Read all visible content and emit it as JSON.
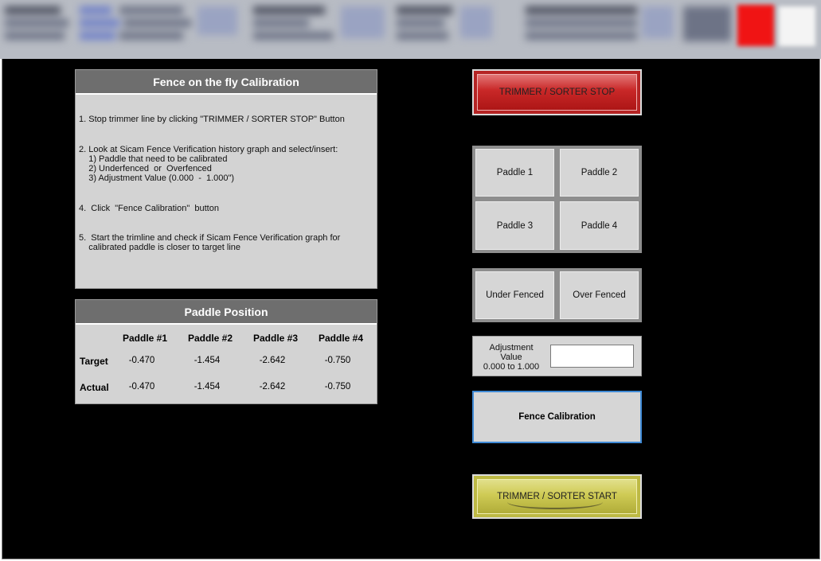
{
  "colors": {
    "background": "#000000",
    "panel": "#d3d3d3",
    "panel_title": "#6e6e6e",
    "stop_button": "#c92828",
    "start_button": "#cfcb55",
    "calibration_border": "#3f8ad6",
    "alarm_indicator": "#f01414"
  },
  "calibration_panel": {
    "title": "Fence on the fly Calibration",
    "steps": [
      "1. Stop trimmer line by clicking \"TRIMMER / SORTER STOP\" Button",
      "2. Look at Sicam Fence Verification history graph and select/insert:",
      "    1) Paddle that need to be calibrated",
      "    2) Underfenced  or  Overfenced",
      "    3) Adjustment Value (0.000  -  1.000\")",
      "4.  Click  \"Fence Calibration\"  button",
      "5.  Start the trimline and check if Sicam Fence Verification graph for",
      "    calibrated paddle is closer to target line"
    ]
  },
  "paddle_position": {
    "title": "Paddle Position",
    "headers": [
      "Paddle #1",
      "Paddle #2",
      "Paddle #3",
      "Paddle #4"
    ],
    "rows": [
      {
        "label": "Target",
        "values": [
          "-0.470",
          "-1.454",
          "-2.642",
          "-0.750"
        ]
      },
      {
        "label": "Actual",
        "values": [
          "-0.470",
          "-1.454",
          "-2.642",
          "-0.750"
        ]
      }
    ]
  },
  "controls": {
    "stop_label": "TRIMMER / SORTER STOP",
    "paddles": [
      "Paddle 1",
      "Paddle 2",
      "Paddle 3",
      "Paddle 4"
    ],
    "fence_modes": [
      "Under Fenced",
      "Over Fenced"
    ],
    "adjustment_label_line1": "Adjustment",
    "adjustment_label_line2": "Value",
    "adjustment_label_line3": "0.000 to 1.000",
    "adjustment_value": "",
    "calibration_label": "Fence Calibration",
    "start_label": "TRIMMER / SORTER START"
  }
}
